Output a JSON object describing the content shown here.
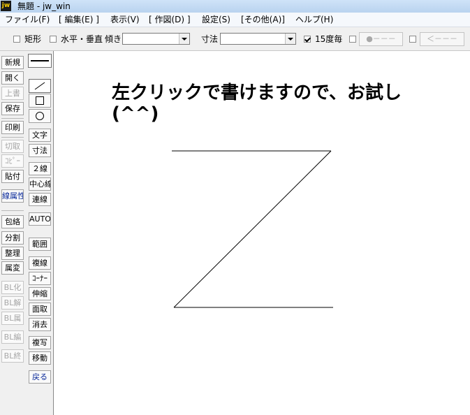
{
  "window": {
    "title": "無題 - jw_win",
    "app_icon": "jw"
  },
  "menu": [
    "ファイル(F)",
    "[ 編集(E) ]",
    "表示(V)",
    "[ 作図(D) ]",
    "設定(S)",
    "[その他(A)]",
    "ヘルプ(H)"
  ],
  "toolbar": {
    "rect_label": "矩形",
    "hv_label": "水平・垂直",
    "tilt_label": "傾き",
    "tilt_value": "",
    "dim_label": "寸法",
    "dim_value": "",
    "deg15_label": "15度毎",
    "deg15_checked": true,
    "btn_circle": "●－－－",
    "btn_arrow": "＜－－－"
  },
  "left_buttons": [
    {
      "label": "新規",
      "state": "enabled"
    },
    {
      "label": "開く",
      "state": "enabled"
    },
    {
      "label": "上書",
      "state": "disabled"
    },
    {
      "label": "保存",
      "state": "enabled"
    },
    {
      "label": "印刷",
      "state": "enabled"
    },
    {
      "label": "切取",
      "state": "disabled"
    },
    {
      "label": "ｺﾋﾟｰ",
      "state": "disabled"
    },
    {
      "label": "貼付",
      "state": "enabled"
    },
    {
      "label": "線属性",
      "state": "blue"
    },
    {
      "label": "包絡",
      "state": "enabled"
    },
    {
      "label": "分割",
      "state": "enabled"
    },
    {
      "label": "整理",
      "state": "enabled"
    },
    {
      "label": "属変",
      "state": "enabled"
    },
    {
      "label": "BL化",
      "state": "disabled"
    },
    {
      "label": "BL解",
      "state": "disabled"
    },
    {
      "label": "BL属",
      "state": "disabled"
    },
    {
      "label": "BL編",
      "state": "disabled"
    },
    {
      "label": "BL終",
      "state": "disabled"
    }
  ],
  "right_buttons": [
    {
      "label": "文字"
    },
    {
      "label": "寸法"
    },
    {
      "label": "２線"
    },
    {
      "label": "中心線"
    },
    {
      "label": "連線"
    },
    {
      "label": "AUTO"
    },
    {
      "label": "範囲"
    },
    {
      "label": "複線"
    },
    {
      "label": "ｺｰﾅｰ"
    },
    {
      "label": "伸縮"
    },
    {
      "label": "面取"
    },
    {
      "label": "消去"
    },
    {
      "label": "複写"
    },
    {
      "label": "移動"
    },
    {
      "label": "戻る"
    }
  ],
  "drawing_tools": [
    "line-tool-icon",
    "rectangle-tool-icon",
    "circle-tool-icon"
  ],
  "canvas": {
    "text": "左クリックで書けますので、お試し(^^)"
  }
}
